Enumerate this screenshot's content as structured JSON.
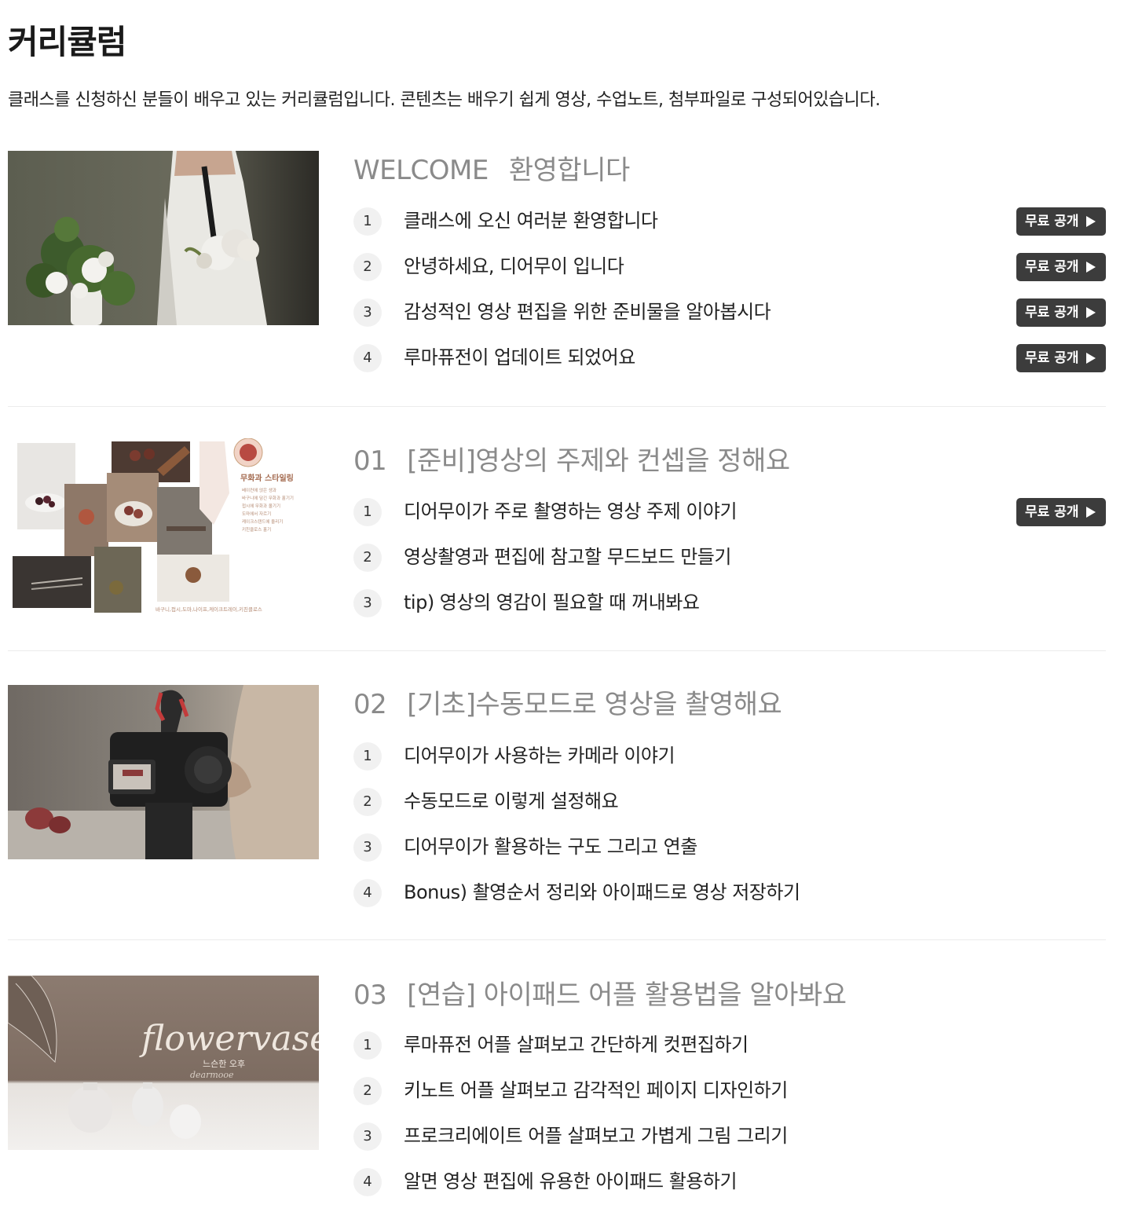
{
  "page": {
    "title": "커리큘럼",
    "description": "클래스를 신청하신 분들이 배우고 있는 커리큘럼입니다. 콘텐츠는 배우기 쉽게 영상, 수업노트, 첨부파일로 구성되어있습니다."
  },
  "free_label": "무료 공개",
  "sections": [
    {
      "num": "WELCOME",
      "title": "환영합니다",
      "lessons": [
        {
          "n": "1",
          "title": "클래스에 오신 여러분 환영합니다",
          "free": true
        },
        {
          "n": "2",
          "title": "안녕하세요, 디어무이 입니다",
          "free": true
        },
        {
          "n": "3",
          "title": "감성적인 영상 편집을 위한 준비물을 알아봅시다",
          "free": true
        },
        {
          "n": "4",
          "title": "루마퓨전이 업데이트 되었어요",
          "free": true
        }
      ]
    },
    {
      "num": "01",
      "title": "[준비]영상의 주제와 컨셉을 정해요",
      "thumb_text": {
        "heading": "무화과 스타일링",
        "lines": [
          "베이컨에 얹은 생과",
          "바구니에 담긴 무화과 홀기기",
          "접시에 무화과 올기기",
          "도마에서 자르기",
          "케이크스탠드에 올리기",
          "키친클로스 홀기"
        ],
        "footer": "바구니,접시,도마,나이프,케이크트레이,키친클로스"
      },
      "lessons": [
        {
          "n": "1",
          "title": "디어무이가 주로 촬영하는 영상 주제 이야기",
          "free": true
        },
        {
          "n": "2",
          "title": "영상촬영과 편집에 참고할 무드보드 만들기",
          "free": false
        },
        {
          "n": "3",
          "title": "tip) 영상의 영감이 필요할 때 꺼내봐요",
          "free": false
        }
      ]
    },
    {
      "num": "02",
      "title": "[기초]수동모드로 영상을 촬영해요",
      "lessons": [
        {
          "n": "1",
          "title": "디어무이가 사용하는 카메라 이야기",
          "free": false
        },
        {
          "n": "2",
          "title": "수동모드로 이렇게 설정해요",
          "free": false
        },
        {
          "n": "3",
          "title": "디어무이가 활용하는 구도 그리고 연출",
          "free": false
        },
        {
          "n": "4",
          "title": "Bonus) 촬영순서 정리와 아이패드로 영상 저장하기",
          "free": false
        }
      ]
    },
    {
      "num": "03",
      "title": "[연습] 아이패드 어플 활용법을 알아봐요",
      "thumb_text": {
        "script": "flowervase",
        "caption": "느슨한 오후",
        "signature": "dearmooe"
      },
      "lessons": [
        {
          "n": "1",
          "title": "루마퓨전 어플 살펴보고 간단하게 컷편집하기",
          "free": false
        },
        {
          "n": "2",
          "title": "키노트 어플 살펴보고 감각적인 페이지 디자인하기",
          "free": false
        },
        {
          "n": "3",
          "title": "프로크리에이트 어플 살펴보고 가볍게 그림 그리기",
          "free": false
        },
        {
          "n": "4",
          "title": "알면 영상 편집에 유용한 아이패드 활용하기",
          "free": false
        }
      ]
    }
  ]
}
